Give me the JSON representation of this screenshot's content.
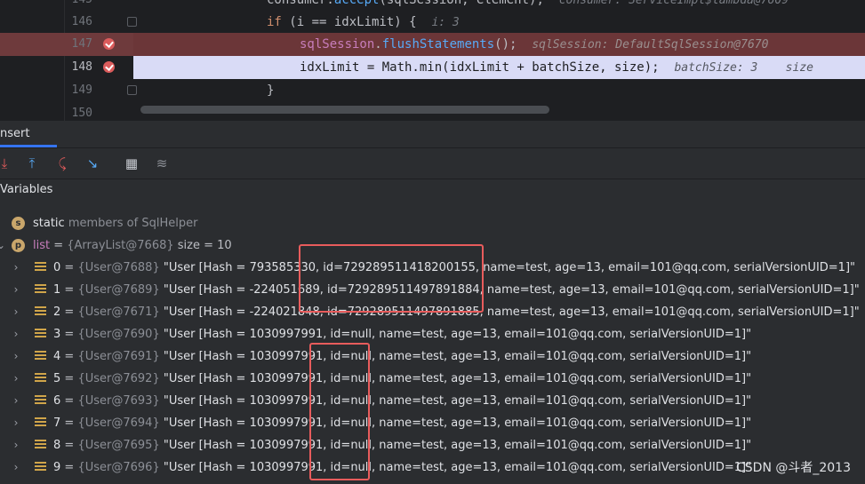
{
  "editor": {
    "lines": [
      {
        "num": "145",
        "code_a": "consumer.",
        "code_b": "accept",
        "code_c": "(sqlSession, element);",
        "hint": "consumer: ServiceImpl$lambda@7609"
      },
      {
        "num": "146",
        "kw": "if",
        "code": " (i == idxLimit) {",
        "hint": "i: 3"
      },
      {
        "num": "147",
        "var": "sqlSession",
        "dot": ".",
        "fn": "flushStatements",
        "rest": "();",
        "hint": "sqlSession: DefaultSqlSession@7670"
      },
      {
        "num": "148",
        "code": "idxLimit = Math.min(idxLimit + batchSize, size);",
        "hint": "batchSize: 3    size"
      },
      {
        "num": "149",
        "code": "}"
      },
      {
        "num": "150",
        "code": ""
      }
    ]
  },
  "debug": {
    "tab_label": "nsert",
    "toolbar_icons": [
      "step-into-icon",
      "step-out-icon",
      "drop-frame-icon",
      "run-to-cursor-icon",
      "evaluate-icon",
      "trace-icon"
    ],
    "variables_label": "Variables",
    "static_row": {
      "badge": "s",
      "text_a": "static",
      "text_b": "members of SqlHelper"
    },
    "list_row": {
      "badge": "p",
      "name": "list",
      "eq": " = ",
      "ref": "{ArrayList@7668}",
      "size": "size = 10"
    },
    "items": [
      {
        "idx": "0",
        "ref": "{User@7688}",
        "value": "\"User [Hash = 793585330, id=729289511418200155, name=test, age=13, email=101@qq.com, serialVersionUID=1]\""
      },
      {
        "idx": "1",
        "ref": "{User@7689}",
        "value": "\"User [Hash = -224051689, id=729289511497891884, name=test, age=13, email=101@qq.com, serialVersionUID=1]\""
      },
      {
        "idx": "2",
        "ref": "{User@7671}",
        "value": "\"User [Hash = -224021848, id=729289511497891885, name=test, age=13, email=101@qq.com, serialVersionUID=1]\""
      },
      {
        "idx": "3",
        "ref": "{User@7690}",
        "value": "\"User [Hash = 1030997991, id=null, name=test, age=13, email=101@qq.com, serialVersionUID=1]\""
      },
      {
        "idx": "4",
        "ref": "{User@7691}",
        "value": "\"User [Hash = 1030997991, id=null, name=test, age=13, email=101@qq.com, serialVersionUID=1]\""
      },
      {
        "idx": "5",
        "ref": "{User@7692}",
        "value": "\"User [Hash = 1030997991, id=null, name=test, age=13, email=101@qq.com, serialVersionUID=1]\""
      },
      {
        "idx": "6",
        "ref": "{User@7693}",
        "value": "\"User [Hash = 1030997991, id=null, name=test, age=13, email=101@qq.com, serialVersionUID=1]\""
      },
      {
        "idx": "7",
        "ref": "{User@7694}",
        "value": "\"User [Hash = 1030997991, id=null, name=test, age=13, email=101@qq.com, serialVersionUID=1]\""
      },
      {
        "idx": "8",
        "ref": "{User@7695}",
        "value": "\"User [Hash = 1030997991, id=null, name=test, age=13, email=101@qq.com, serialVersionUID=1]\""
      },
      {
        "idx": "9",
        "ref": "{User@7696}",
        "value": "\"User [Hash = 1030997991, id=null, name=test, age=13, email=101@qq.com, serialVersionUID=1]\""
      }
    ]
  },
  "watermark": "CSDN @斗者_2013",
  "colors": {
    "breakpoint": "#db5c5c",
    "annotation_box": "#e85c5c",
    "current_line": "#d9dbf6",
    "accent": "#3574f0"
  }
}
